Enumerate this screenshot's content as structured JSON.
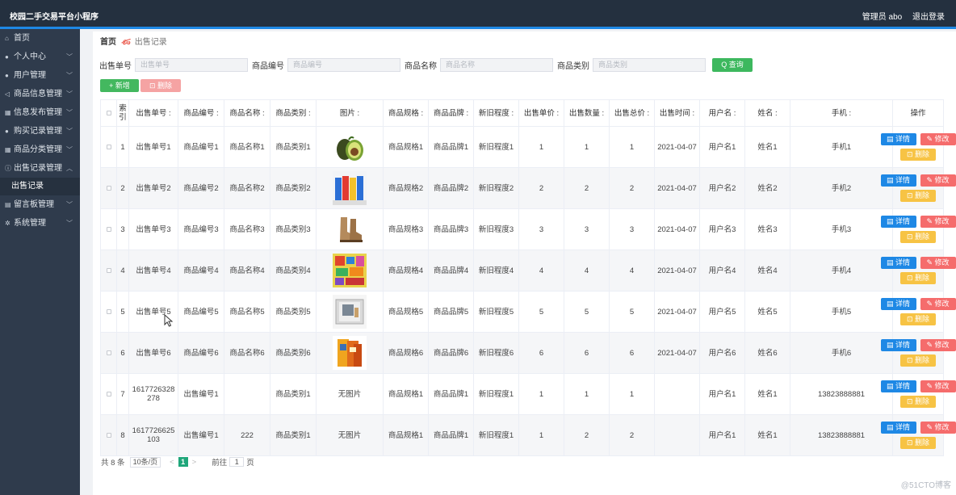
{
  "header": {
    "app_title": "校园二手交易平台小程序",
    "admin_label": "管理员 abo",
    "logout_label": "退出登录"
  },
  "sidebar": {
    "items": [
      {
        "label": "首页",
        "icon": "home-icon",
        "glyph": "⌂",
        "chevron": ""
      },
      {
        "label": "个人中心",
        "icon": "user-icon",
        "glyph": "●",
        "chevron": "﹀"
      },
      {
        "label": "用户管理",
        "icon": "user-icon",
        "glyph": "●",
        "chevron": "﹀"
      },
      {
        "label": "商品信息管理",
        "icon": "send-icon",
        "glyph": "◁",
        "chevron": "﹀"
      },
      {
        "label": "信息发布管理",
        "icon": "doc-icon",
        "glyph": "▦",
        "chevron": "﹀"
      },
      {
        "label": "购买记录管理",
        "icon": "user-icon",
        "glyph": "●",
        "chevron": "﹀"
      },
      {
        "label": "商品分类管理",
        "icon": "grid-icon",
        "glyph": "▦",
        "chevron": "﹀"
      },
      {
        "label": "出售记录管理",
        "icon": "info-icon",
        "glyph": "ⓘ",
        "chevron": "︿"
      }
    ],
    "active_sub": "出售记录",
    "items_after": [
      {
        "label": "留言板管理",
        "icon": "doc-icon",
        "glyph": "▤",
        "chevron": "﹀"
      },
      {
        "label": "系统管理",
        "icon": "gear-icon",
        "glyph": "✲",
        "chevron": "﹀"
      }
    ]
  },
  "breadcrumb": {
    "home": "首页",
    "separator": "ණ",
    "current": "出售记录"
  },
  "search": {
    "fields": [
      {
        "label": "出售单号",
        "placeholder": "出售单号"
      },
      {
        "label": "商品编号",
        "placeholder": "商品编号"
      },
      {
        "label": "商品名称",
        "placeholder": "商品名称"
      },
      {
        "label": "商品类别",
        "placeholder": "商品类别"
      }
    ],
    "button": "Q 查询"
  },
  "toolbar": {
    "add_label": "+ 新增",
    "delete_label": "⊡ 删除"
  },
  "table": {
    "headers": {
      "index": "索引",
      "order_no": "出售单号 :",
      "product_no": "商品编号 :",
      "product_name": "商品名称 :",
      "category": "商品类别 :",
      "image": "图片 :",
      "spec": "商品规格 :",
      "brand": "商品品牌 :",
      "condition": "新旧程度 :",
      "price": "出售单价 :",
      "qty": "出售数量 :",
      "total": "出售总价 :",
      "time": "出售时间 :",
      "username": "用户名 :",
      "name": "姓名 :",
      "phone": "手机 :",
      "ops": "操作"
    },
    "op_labels": {
      "detail": "▤ 详情",
      "edit": "✎ 修改",
      "delete": "⊡ 删除"
    },
    "rows": [
      {
        "idx": "1",
        "order_no": "出售单号1",
        "product_no": "商品编号1",
        "product_name": "商品名称1",
        "category": "商品类别1",
        "image": "avocado",
        "spec": "商品规格1",
        "brand": "商品品牌1",
        "condition": "新旧程度1",
        "price": "1",
        "qty": "1",
        "total": "1",
        "time": "2021-04-07",
        "username": "用户名1",
        "name": "姓名1",
        "phone": "手机1"
      },
      {
        "idx": "2",
        "order_no": "出售单号2",
        "product_no": "商品编号2",
        "product_name": "商品名称2",
        "category": "商品类别2",
        "image": "bottles",
        "spec": "商品规格2",
        "brand": "商品品牌2",
        "condition": "新旧程度2",
        "price": "2",
        "qty": "2",
        "total": "2",
        "time": "2021-04-07",
        "username": "用户名2",
        "name": "姓名2",
        "phone": "手机2"
      },
      {
        "idx": "3",
        "order_no": "出售单号3",
        "product_no": "商品编号3",
        "product_name": "商品名称3",
        "category": "商品类别3",
        "image": "boots",
        "spec": "商品规格3",
        "brand": "商品品牌3",
        "condition": "新旧程度3",
        "price": "3",
        "qty": "3",
        "total": "3",
        "time": "2021-04-07",
        "username": "用户名3",
        "name": "姓名3",
        "phone": "手机3"
      },
      {
        "idx": "4",
        "order_no": "出售单号4",
        "product_no": "商品编号4",
        "product_name": "商品名称4",
        "category": "商品类别4",
        "image": "poster",
        "spec": "商品规格4",
        "brand": "商品品牌4",
        "condition": "新旧程度4",
        "price": "4",
        "qty": "4",
        "total": "4",
        "time": "2021-04-07",
        "username": "用户名4",
        "name": "姓名4",
        "phone": "手机4"
      },
      {
        "idx": "5",
        "order_no": "出售单号5",
        "product_no": "商品编号5",
        "product_name": "商品名称5",
        "category": "商品类别5",
        "image": "book",
        "spec": "商品规格5",
        "brand": "商品品牌5",
        "condition": "新旧程度5",
        "price": "5",
        "qty": "5",
        "total": "5",
        "time": "2021-04-07",
        "username": "用户名5",
        "name": "姓名5",
        "phone": "手机5"
      },
      {
        "idx": "6",
        "order_no": "出售单号6",
        "product_no": "商品编号6",
        "product_name": "商品名称6",
        "category": "商品类别6",
        "image": "bookstack",
        "spec": "商品规格6",
        "brand": "商品品牌6",
        "condition": "新旧程度6",
        "price": "6",
        "qty": "6",
        "total": "6",
        "time": "2021-04-07",
        "username": "用户名6",
        "name": "姓名6",
        "phone": "手机6"
      },
      {
        "idx": "7",
        "order_no": "1617726328278",
        "product_no": "出售编号1",
        "product_name": "",
        "category": "商品类别1",
        "image": "",
        "image_text": "无图片",
        "spec": "商品规格1",
        "brand": "商品品牌1",
        "condition": "新旧程度1",
        "price": "1",
        "qty": "1",
        "total": "1",
        "time": "",
        "username": "用户名1",
        "name": "姓名1",
        "phone": "13823888881"
      },
      {
        "idx": "8",
        "order_no": "1617726625103",
        "product_no": "出售编号1",
        "product_name": "222",
        "category": "商品类别1",
        "image": "",
        "image_text": "无图片",
        "spec": "商品规格1",
        "brand": "商品品牌1",
        "condition": "新旧程度1",
        "price": "1",
        "qty": "2",
        "total": "2",
        "time": "",
        "username": "用户名1",
        "name": "姓名1",
        "phone": "13823888881"
      }
    ]
  },
  "pagination": {
    "total_label": "共 8 条",
    "page_size": "10条/页",
    "prev": "<",
    "current": "1",
    "next": ">",
    "goto_label": "前往",
    "goto_value": "1",
    "page_suffix": "页"
  },
  "watermark": "@51CTO博客"
}
